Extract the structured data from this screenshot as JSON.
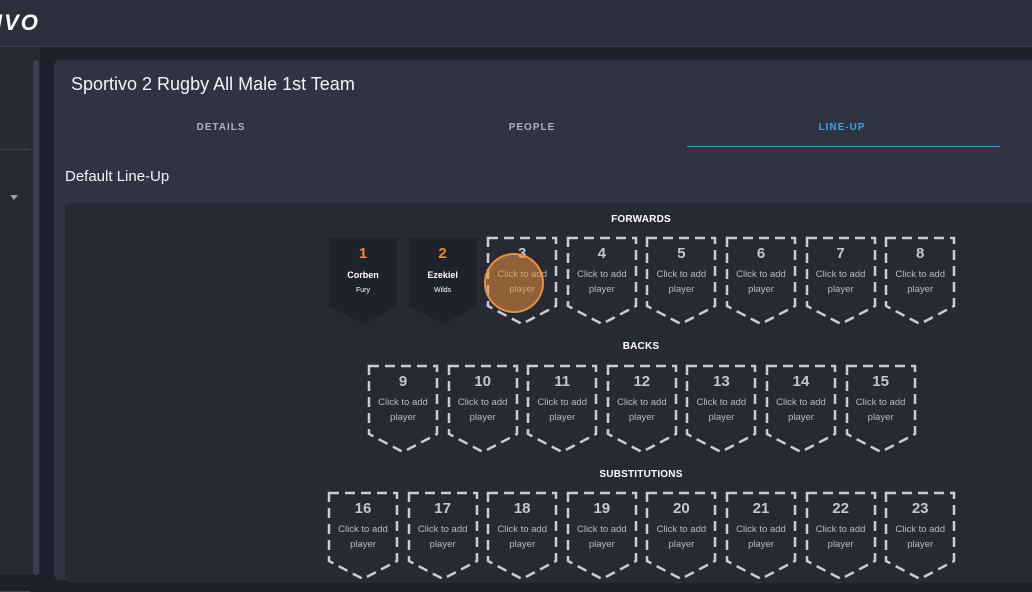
{
  "app": {
    "logo_text": "IVO"
  },
  "team": {
    "title": "Sportivo 2 Rugby All Male 1st Team"
  },
  "tabs": [
    {
      "label": "DETAILS",
      "active": false
    },
    {
      "label": "PEOPLE",
      "active": false
    },
    {
      "label": "LINE-UP",
      "active": true
    }
  ],
  "lineup": {
    "title": "Default Line-Up",
    "add_text_line1": "Click to add",
    "add_text_line2": "player",
    "forwards": {
      "label": "FORWARDS",
      "slots": [
        {
          "number": "1",
          "first_name": "Corben",
          "last_name": "Fury",
          "filled": true
        },
        {
          "number": "2",
          "first_name": "Ezekiel",
          "last_name": "Wilds",
          "filled": true
        },
        {
          "number": "3",
          "filled": false
        },
        {
          "number": "4",
          "filled": false
        },
        {
          "number": "5",
          "filled": false
        },
        {
          "number": "6",
          "filled": false
        },
        {
          "number": "7",
          "filled": false
        },
        {
          "number": "8",
          "filled": false
        }
      ]
    },
    "backs": {
      "label": "BACKS",
      "slots": [
        {
          "number": "9",
          "filled": false
        },
        {
          "number": "10",
          "filled": false
        },
        {
          "number": "11",
          "filled": false
        },
        {
          "number": "12",
          "filled": false
        },
        {
          "number": "13",
          "filled": false
        },
        {
          "number": "14",
          "filled": false
        },
        {
          "number": "15",
          "filled": false
        }
      ]
    },
    "substitutions": {
      "label": "SUBSTITUTIONS",
      "slots": [
        {
          "number": "16",
          "filled": false
        },
        {
          "number": "17",
          "filled": false
        },
        {
          "number": "18",
          "filled": false
        },
        {
          "number": "19",
          "filled": false
        },
        {
          "number": "20",
          "filled": false
        },
        {
          "number": "21",
          "filled": false
        },
        {
          "number": "22",
          "filled": false
        },
        {
          "number": "23",
          "filled": false
        }
      ]
    }
  },
  "colors": {
    "accent": "#3aa3e6",
    "number_filled": "#f0882f",
    "slot_border": "#c9ccd3",
    "slot_fill": "#1f222b"
  }
}
